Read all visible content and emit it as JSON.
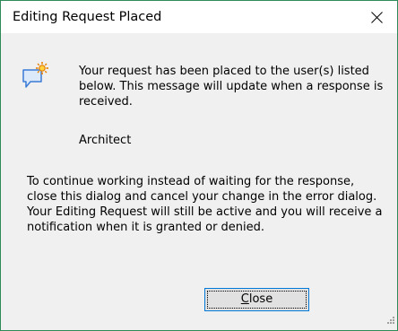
{
  "dialog": {
    "title": "Editing Request Placed",
    "icon": "speech-bubble-star-icon",
    "message": "Your request has been placed to the user(s) listed below. This message will update when a response is received.",
    "users": [
      "Architect"
    ],
    "info": "To continue working instead of waiting for the response, close this dialog and cancel your change in the error dialog.  Your Editing Request will still be active and you will receive a notification when it is granted or denied.",
    "close_button": {
      "mnemonic": "C",
      "rest": "lose"
    }
  },
  "colors": {
    "window_border": "#2e8b57",
    "focus_border": "#0078d7",
    "icon_accent": "#e67e00",
    "icon_bubble": "#3a7bd5"
  }
}
